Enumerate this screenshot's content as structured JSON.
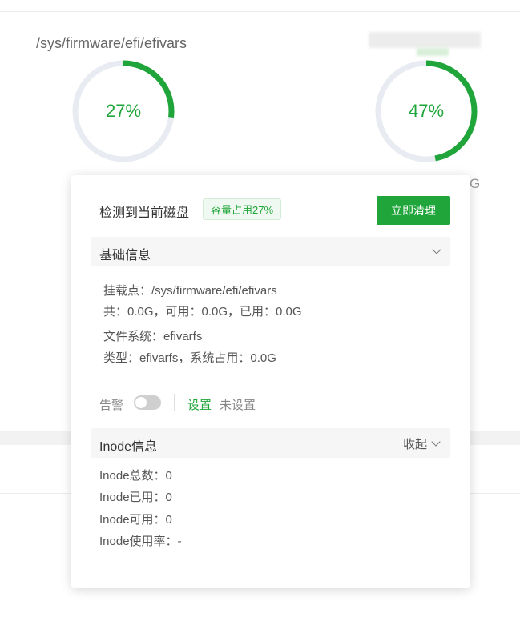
{
  "disks": [
    {
      "path": "/sys/firmware/efi/efivars",
      "percent": 27,
      "percent_label": "27%"
    },
    {
      "percent": 47,
      "percent_label": "47%"
    }
  ],
  "background": {
    "right_size_fragment": "G"
  },
  "colors": {
    "accent": "#20a53a",
    "track": "#e8ebf2"
  },
  "popup": {
    "title": "检测到当前磁盘",
    "usage_badge": "容量占用27%",
    "clean_button": "立即清理",
    "basic_section": {
      "title": "基础信息",
      "mount_point": "挂载点：/sys/firmware/efi/efivars",
      "totals": "共：0.0G，可用：0.0G，已用：0.0G",
      "filesystem": "文件系统：efivarfs",
      "type": "类型：efivarfs，系统占用：0.0G"
    },
    "alert": {
      "label": "告警",
      "enabled": false,
      "setting_link": "设置",
      "status": "未设置"
    },
    "inode_section": {
      "title": "Inode信息",
      "collapse_label": "收起",
      "total": "Inode总数：0",
      "used": "Inode已用：0",
      "available": "Inode可用：0",
      "usage_rate": "Inode使用率：-"
    }
  }
}
